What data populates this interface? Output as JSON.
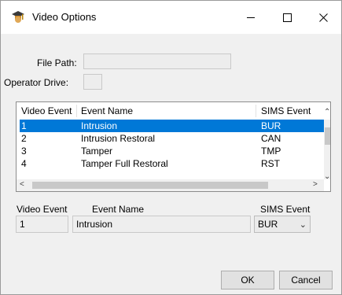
{
  "window": {
    "title": "Video Options",
    "minimize": "—",
    "maximize": "☐",
    "close": "✕"
  },
  "form": {
    "file_path_label": "File Path:",
    "file_path_value": "",
    "operator_drive_label": "Operator Drive:",
    "operator_drive_value": ""
  },
  "grid": {
    "columns": [
      "Video Event",
      "Event Name",
      "SIMS Event"
    ],
    "rows": [
      {
        "video_event": "1",
        "event_name": "Intrusion",
        "sims_event": "BUR",
        "selected": true
      },
      {
        "video_event": "2",
        "event_name": "Intrusion Restoral",
        "sims_event": "CAN",
        "selected": false
      },
      {
        "video_event": "3",
        "event_name": "Tamper",
        "sims_event": "TMP",
        "selected": false
      },
      {
        "video_event": "4",
        "event_name": "Tamper Full Restoral",
        "sims_event": "RST",
        "selected": false
      }
    ]
  },
  "detail": {
    "video_event_label": "Video Event",
    "video_event_value": "1",
    "event_name_label": "Event Name",
    "event_name_value": "Intrusion",
    "sims_event_label": "SIMS Event",
    "sims_event_value": "BUR"
  },
  "buttons": {
    "ok": "OK",
    "cancel": "Cancel"
  },
  "colors": {
    "selection": "#0078d7",
    "background": "#f0f0f0"
  }
}
